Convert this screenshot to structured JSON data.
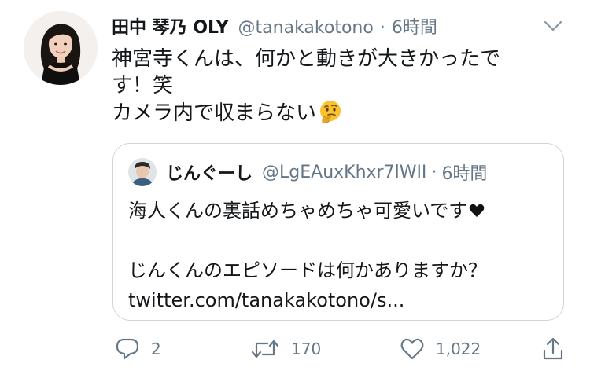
{
  "tweet": {
    "display_name": "田中 琴乃 OLY",
    "handle": "@tanakakotono",
    "dot": "·",
    "time": "6時間",
    "text_lines": [
      "神宮寺くんは、何かと動きが大きかったで",
      "す！笑",
      "カメラ内で収まらない"
    ],
    "emoji": "thinking-face-emoji",
    "caret_icon": "chevron-down-icon"
  },
  "quote": {
    "display_name": "じんぐーし",
    "handle": "@LgEAuxKhxr7lWII",
    "dot": "·",
    "time": "6時間",
    "text_lines": [
      "海人くんの裏話めちゃめちゃ可愛いです",
      "",
      "じんくんのエピソードは何かありますか？",
      "twitter.com/tanakakotono/s..."
    ],
    "emoji": "black-heart-emoji"
  },
  "actions": {
    "reply_count": "2",
    "retweet_count": "170",
    "like_count": "1,022",
    "reply_icon": "reply-icon",
    "retweet_icon": "retweet-icon",
    "like_icon": "heart-icon",
    "share_icon": "share-icon"
  },
  "colors": {
    "text": "#14171a",
    "secondary": "#657786",
    "border": "#ccd6dd",
    "background": "#ffffff"
  }
}
